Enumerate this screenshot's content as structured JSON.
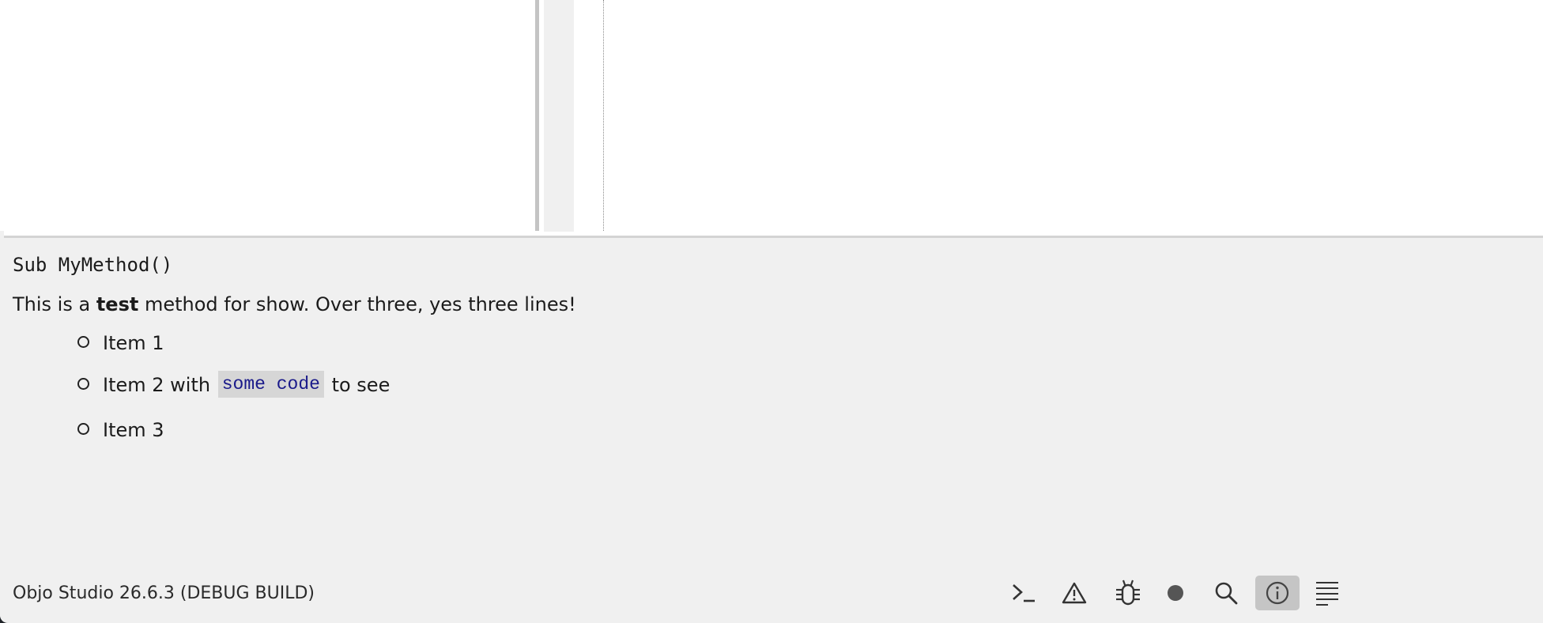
{
  "doc": {
    "signature": "Sub MyMethod()",
    "description_prefix": "This is a ",
    "description_bold": "test",
    "description_suffix": " method for show. Over three, yes three lines!",
    "items": [
      {
        "text": "Item 1"
      },
      {
        "text_before": "Item 2 with ",
        "code": "some code",
        "text_after": " to see"
      },
      {
        "text": "Item 3"
      }
    ]
  },
  "status_bar": {
    "version": "Objo Studio 26.6.3 (DEBUG BUILD)",
    "tools": [
      {
        "name": "terminal-icon",
        "active": false
      },
      {
        "name": "warning-icon",
        "active": false
      },
      {
        "name": "bug-icon",
        "active": false
      },
      {
        "name": "breakpoint-icon",
        "active": false
      },
      {
        "name": "search-icon",
        "active": false
      },
      {
        "name": "info-icon",
        "active": true
      },
      {
        "name": "lines-icon",
        "active": false
      }
    ]
  },
  "colors": {
    "panel_bg": "#f0f0f0",
    "editor_bg": "#ffffff",
    "code_bg": "#d6d6d6",
    "code_fg": "#1a1a8a",
    "active_tool_bg": "#c5c5c5"
  }
}
